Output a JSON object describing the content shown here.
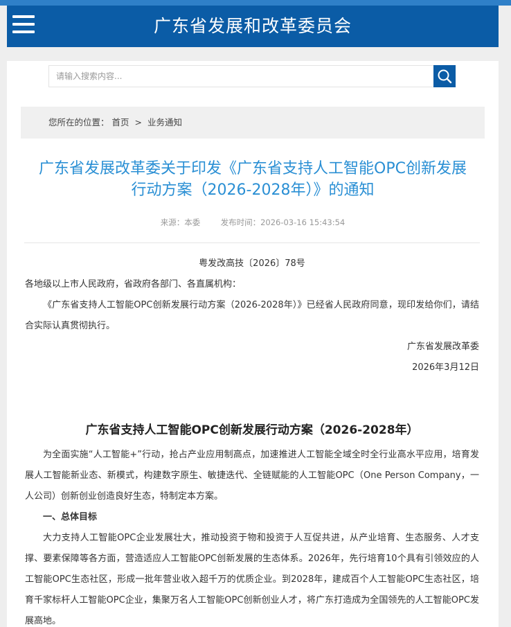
{
  "header": {
    "title": "广东省发展和改革委员会",
    "menu_icon": "hamburger-menu-icon"
  },
  "search": {
    "placeholder": "请输入搜索内容...",
    "value": "",
    "button_icon": "search-icon"
  },
  "breadcrumb": {
    "prefix": "您所在的位置：",
    "home": "首页",
    "separator": ">",
    "current": "业务通知"
  },
  "article": {
    "title": "广东省发展改革委关于印发《广东省支持人工智能OPC创新发展行动方案（2026-2028年）》的通知",
    "source_label": "来源：本委",
    "publish_label": "发布时间：2026-03-16 15:43:54",
    "doc_number": "粤发改高技〔2026〕78号",
    "recipients": "各地级以上市人民政府，省政府各部门、各直属机构：",
    "intro": "《广东省支持人工智能OPC创新发展行动方案（2026-2028年）》已经省人民政府同意，现印发给你们，请结合实际认真贯彻执行。",
    "signature": "广东省发展改革委",
    "date": "2026年3月12日",
    "plan_title": "广东省支持人工智能OPC创新发展行动方案（2026-2028年）",
    "para1": "为全面实施“人工智能+”行动，抢占产业应用制高点，加速推进人工智能全域全时全行业高水平应用，培育发展人工智能新业态、新模式，构建数字原生、敏捷迭代、全链赋能的人工智能OPC（One Person Company，一人公司）创新创业创造良好生态，特制定本方案。",
    "section1": "一、总体目标",
    "para2": "大力支持人工智能OPC企业发展壮大，推动投资于物和投资于人互促共进，从产业培育、生态服务、人才支撑、要素保障等各方面，营造适应人工智能OPC创新发展的生态体系。2026年，先行培育10个具有引领效应的人工智能OPC生态社区，形成一批年营业收入超千万的优质企业。到2028年，建成百个人工智能OPC生态社区，培育千家标杆人工智能OPC企业，集聚万名人工智能OPC创新创业人才，将广东打造成为全国领先的人工智能OPC发展高地。"
  },
  "colors": {
    "header_bg": "#0b5ca6",
    "title_blue": "#2a8fd4",
    "page_bg": "#eeeeee"
  }
}
